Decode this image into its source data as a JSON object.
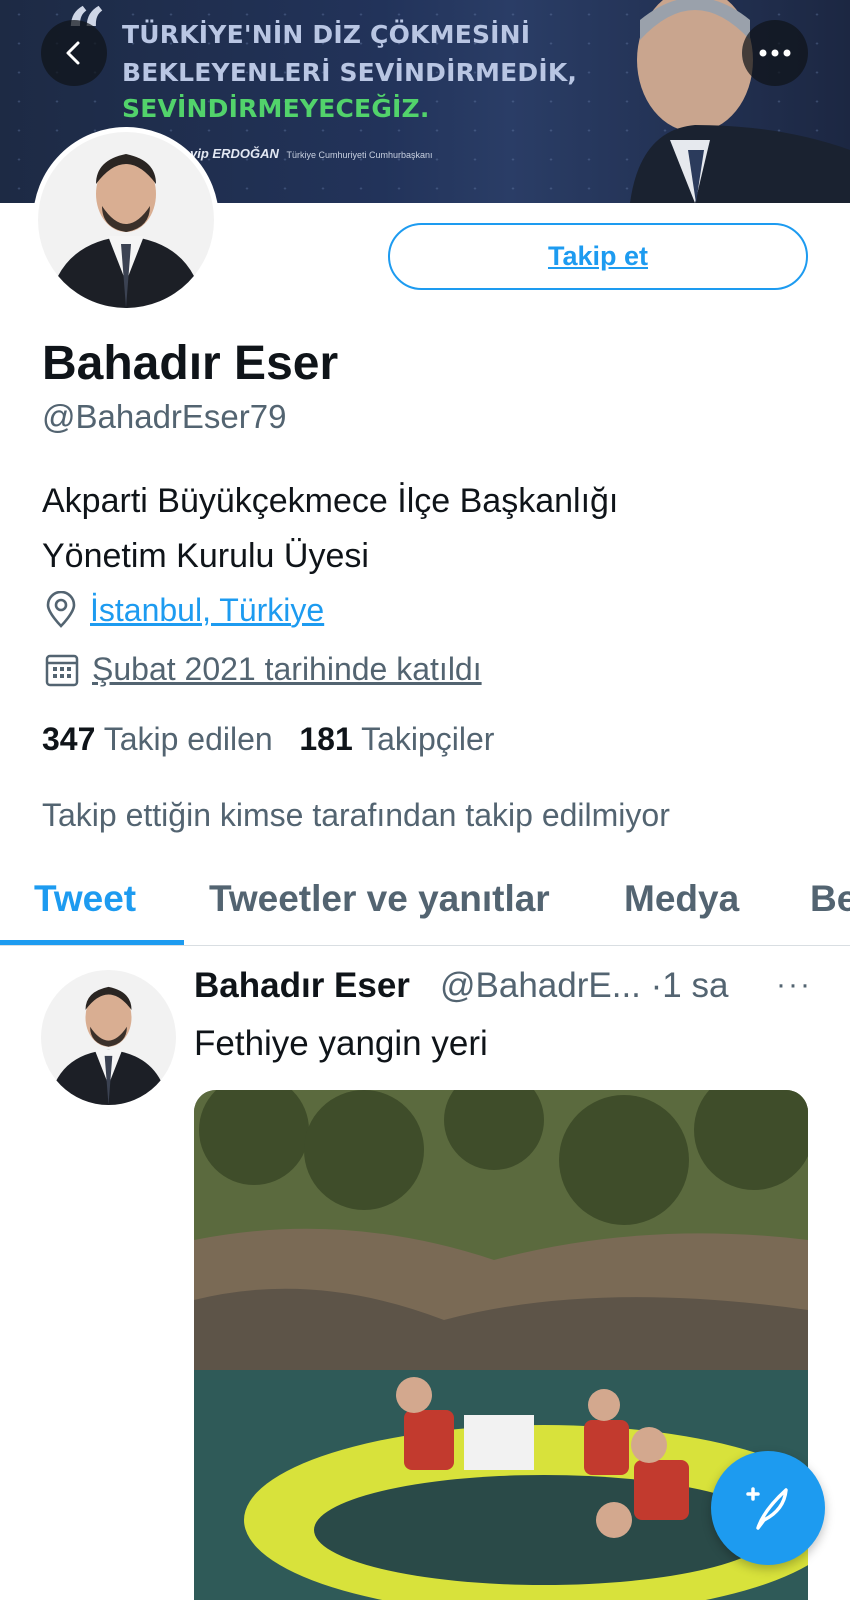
{
  "banner": {
    "line1": "TÜRKİYE'NİN DİZ ÇÖKMESİNİ",
    "line2": "BEKLEYENLERİ SEVİNDİRMEDİK,",
    "line3": "SEVİNDİRMEYECEĞİZ.",
    "signature": "yip ERDOĞAN",
    "signature_title": "Türkiye Cumhuriyeti Cumhurbaşkanı"
  },
  "actions": {
    "follow_label": "Takip et"
  },
  "profile": {
    "name": "Bahadır Eser",
    "handle": "@BahadrEser79",
    "bio_line1": "Akparti Büyükçekmece İlçe Başkanlığı",
    "bio_line2": "Yönetim Kurulu Üyesi",
    "location": "İstanbul, Türkiye",
    "joined": "Şubat 2021 tarihinde katıldı",
    "following_count": "347",
    "following_label": "Takip edilen",
    "followers_count": "181",
    "followers_label": "Takipçiler",
    "followed_by": "Takip ettiğin kimse tarafından takip edilmiyor"
  },
  "tabs": [
    {
      "label": "Tweet",
      "active": true
    },
    {
      "label": "Tweetler ve yanıtlar"
    },
    {
      "label": "Medya"
    },
    {
      "label": "Be"
    }
  ],
  "tweet": {
    "name": "Bahadır Eser",
    "handle_time": "@BahadrE... ·1 sa",
    "more": "···",
    "text": "Fethiye yangin yeri"
  },
  "colors": {
    "accent": "#1d9bf0",
    "secondary_text": "#536471"
  },
  "icons": [
    "back-arrow-icon",
    "more-icon",
    "location-pin-icon",
    "calendar-icon",
    "compose-tweet-icon"
  ]
}
